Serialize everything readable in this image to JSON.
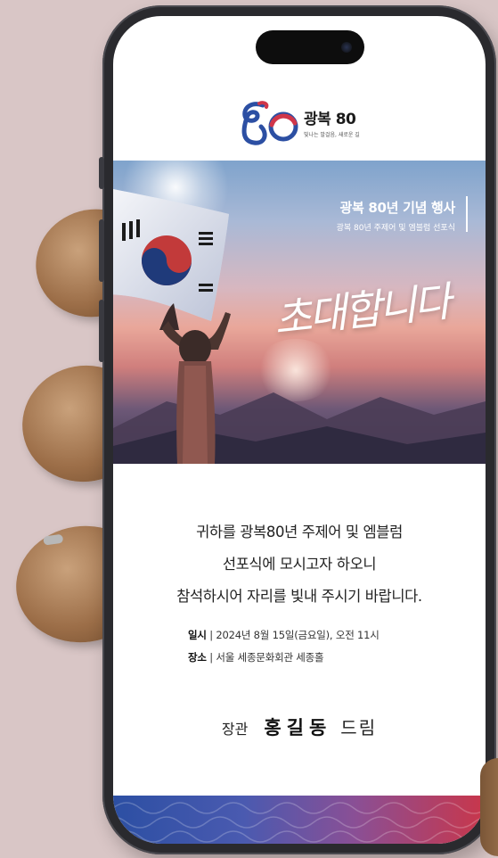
{
  "logo": {
    "title": "광복 80",
    "subtitle": "빛나는 발걸음, 새로운 길"
  },
  "hero": {
    "title": "광복 80년 기념 행사",
    "subtitle": "광복 80년 주제어 및 엠블럼 선포식",
    "script": "초대합니다"
  },
  "invitation": {
    "line1": "귀하를 광복80년 주제어 및 엠블럼",
    "line2": "선포식에 모시고자 하오니",
    "line3": "참석하시어 자리를 빛내 주시기 바랍니다."
  },
  "details": {
    "date_label": "일시",
    "date_value": " | 2024년 8월 15일(금요일), 오전 11시",
    "place_label": "장소",
    "place_value": " | 서울 세종문화회관 세종홀"
  },
  "sender": {
    "role": "장관",
    "name": "홍길동",
    "suffix": "드림"
  },
  "colors": {
    "blue": "#2c4fa3",
    "red": "#c9364a",
    "background": "#d9c6c6"
  }
}
